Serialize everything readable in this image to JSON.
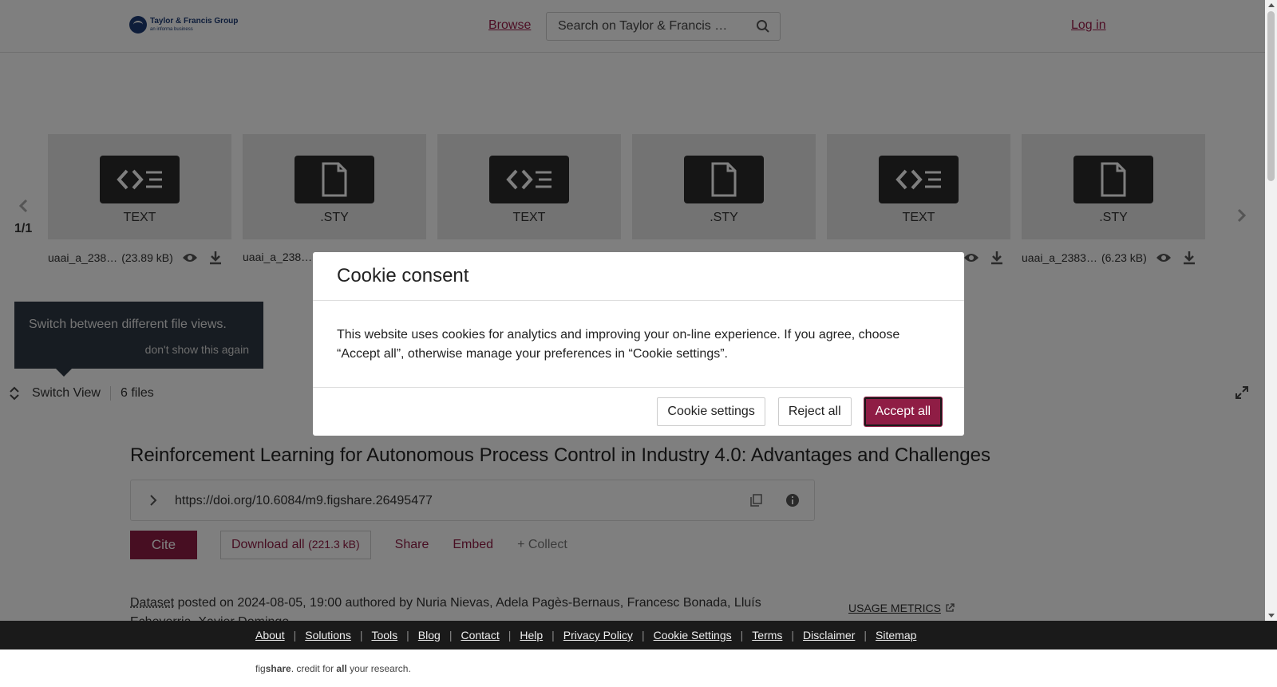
{
  "header": {
    "logo_main": "Taylor & Francis Group",
    "logo_sub": "an informa business",
    "browse": "Browse",
    "search_placeholder": "Search on Taylor & Francis …",
    "login": "Log in"
  },
  "viewer": {
    "page_indicator": "1/1",
    "files": [
      {
        "type": "TEXT",
        "icon": "code-file-icon",
        "name": "uaai_a_238…",
        "size": "(23.89 kB)"
      },
      {
        "type": ".STY",
        "icon": "document-icon",
        "name": "uaai_a_238…",
        "size": ""
      },
      {
        "type": "TEXT",
        "icon": "code-file-icon",
        "name": "",
        "size": ""
      },
      {
        "type": ".STY",
        "icon": "document-icon",
        "name": "",
        "size": ""
      },
      {
        "type": "TEXT",
        "icon": "code-file-icon",
        "name": "",
        "size": ""
      },
      {
        "type": ".STY",
        "icon": "document-icon",
        "name": "uaai_a_2383…",
        "size": "(6.23 kB)"
      }
    ],
    "tooltip_text": "Switch between different file views.",
    "tooltip_dismiss": "don't show this again",
    "switch_view": "Switch View",
    "file_count": "6 files"
  },
  "item": {
    "title": "Reinforcement Learning for Autonomous Process Control in Industry 4.0: Advantages and Challenges",
    "doi": "https://doi.org/10.6084/m9.figshare.26495477",
    "cite": "Cite",
    "download_label": "Download all",
    "download_size": "(221.3 kB)",
    "share": "Share",
    "embed": "Embed",
    "collect": "+ Collect",
    "dataset": "Dataset",
    "posted_text": " posted on 2024-08-05, 19:00 authored by Nuria Nievas, Adela Pagès-Bernaus, Francesc Bonada, Lluís Echeverria, Xavier Domingo",
    "usage_metrics": "USAGE METRICS"
  },
  "footer": {
    "links": [
      "About",
      "Solutions",
      "Tools",
      "Blog",
      "Contact",
      "Help",
      "Privacy Policy",
      "Cookie Settings",
      "Terms",
      "Disclaimer",
      "Sitemap"
    ],
    "credit_pre": "fig",
    "credit_brand": "share",
    "credit_mid": ". credit for ",
    "credit_all": "all",
    "credit_post": " your research."
  },
  "cookie": {
    "title": "Cookie consent",
    "body": "This website uses cookies for analytics and improving your on-line experience. If you agree, choose “Accept all”, otherwise manage your preferences in “Cookie settings”.",
    "settings": "Cookie settings",
    "reject": "Reject all",
    "accept": "Accept all"
  },
  "colors": {
    "brand": "#8f1d45",
    "link": "#9b1b49",
    "footer_bg": "#1a1a1a"
  }
}
